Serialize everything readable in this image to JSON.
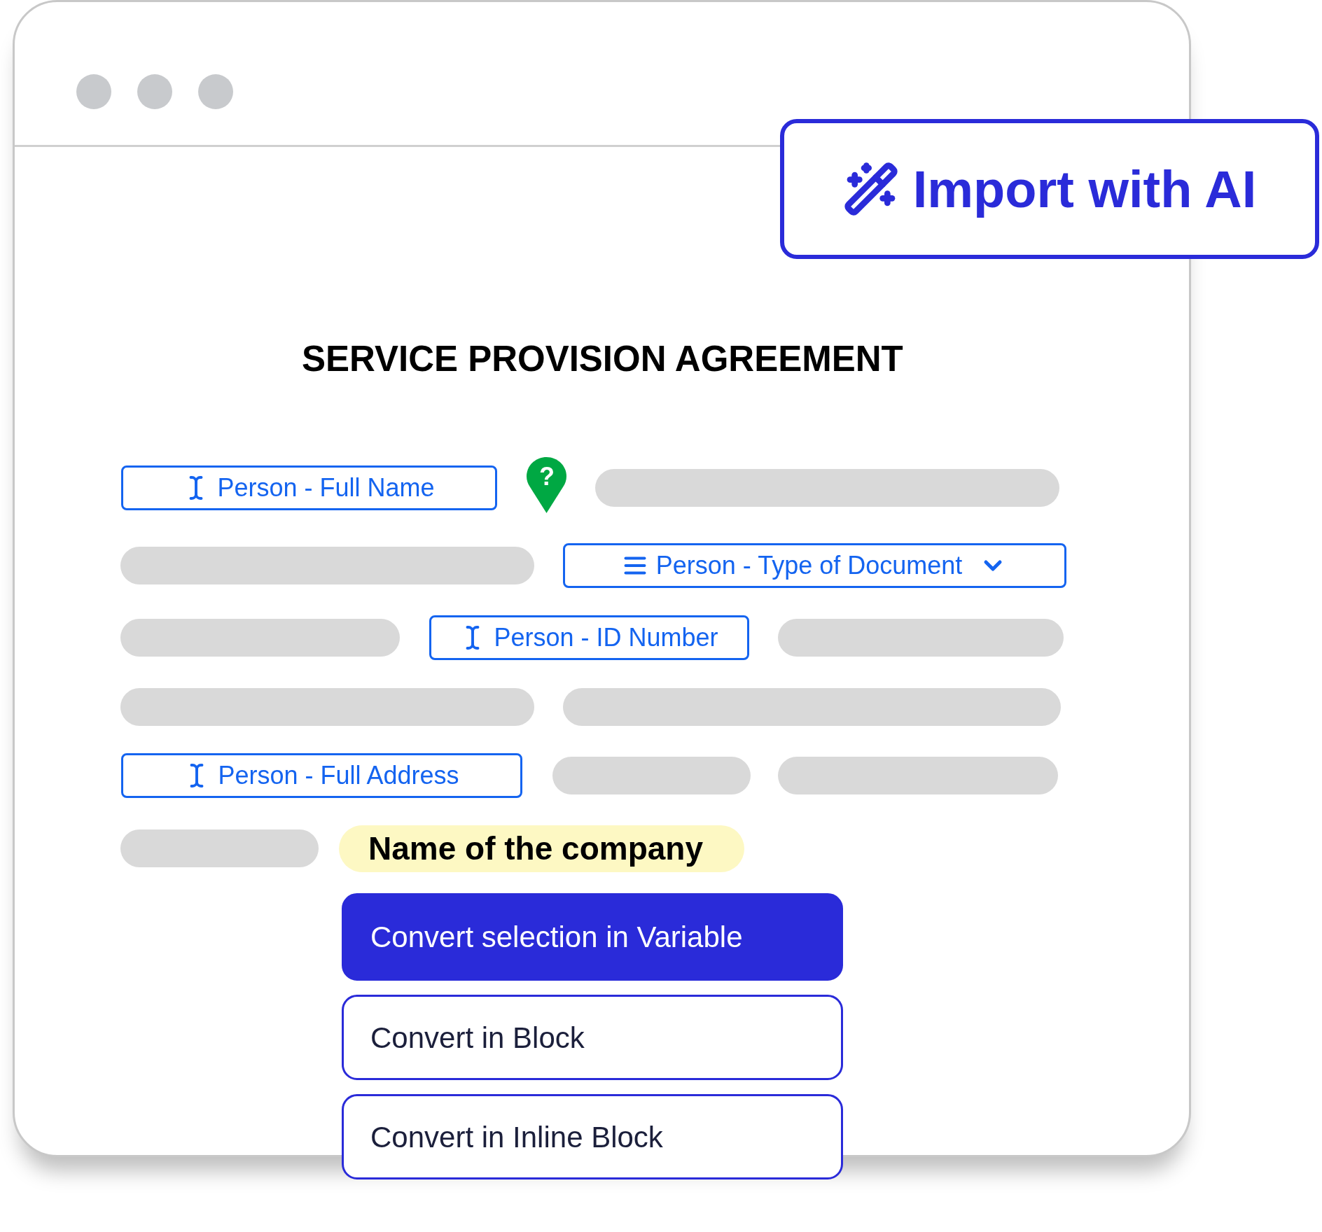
{
  "import_button": {
    "label": "Import with AI"
  },
  "document": {
    "title": "SERVICE PROVISION AGREEMENT",
    "rows": [
      {
        "items": [
          {
            "kind": "text_variable",
            "label": "Person - Full Name",
            "dropdown": false
          },
          {
            "kind": "pin",
            "label": "?"
          },
          {
            "kind": "bar"
          }
        ]
      },
      {
        "items": [
          {
            "kind": "bar"
          },
          {
            "kind": "list_variable",
            "label": "Person - Type of Document",
            "dropdown": true
          }
        ]
      },
      {
        "items": [
          {
            "kind": "bar"
          },
          {
            "kind": "text_variable",
            "label": "Person - ID Number",
            "dropdown": false
          },
          {
            "kind": "bar"
          }
        ]
      },
      {
        "items": [
          {
            "kind": "bar"
          },
          {
            "kind": "bar"
          }
        ]
      },
      {
        "items": [
          {
            "kind": "text_variable",
            "label": "Person - Full Address",
            "dropdown": false
          },
          {
            "kind": "bar"
          },
          {
            "kind": "bar"
          }
        ]
      },
      {
        "items": [
          {
            "kind": "bar"
          },
          {
            "kind": "highlight",
            "label": "Name of the company"
          }
        ]
      }
    ]
  },
  "menu": [
    {
      "label": "Convert selection in Variable",
      "selected": true
    },
    {
      "label": "Convert in Block",
      "selected": false
    },
    {
      "label": "Convert in Inline Block",
      "selected": false
    }
  ]
}
